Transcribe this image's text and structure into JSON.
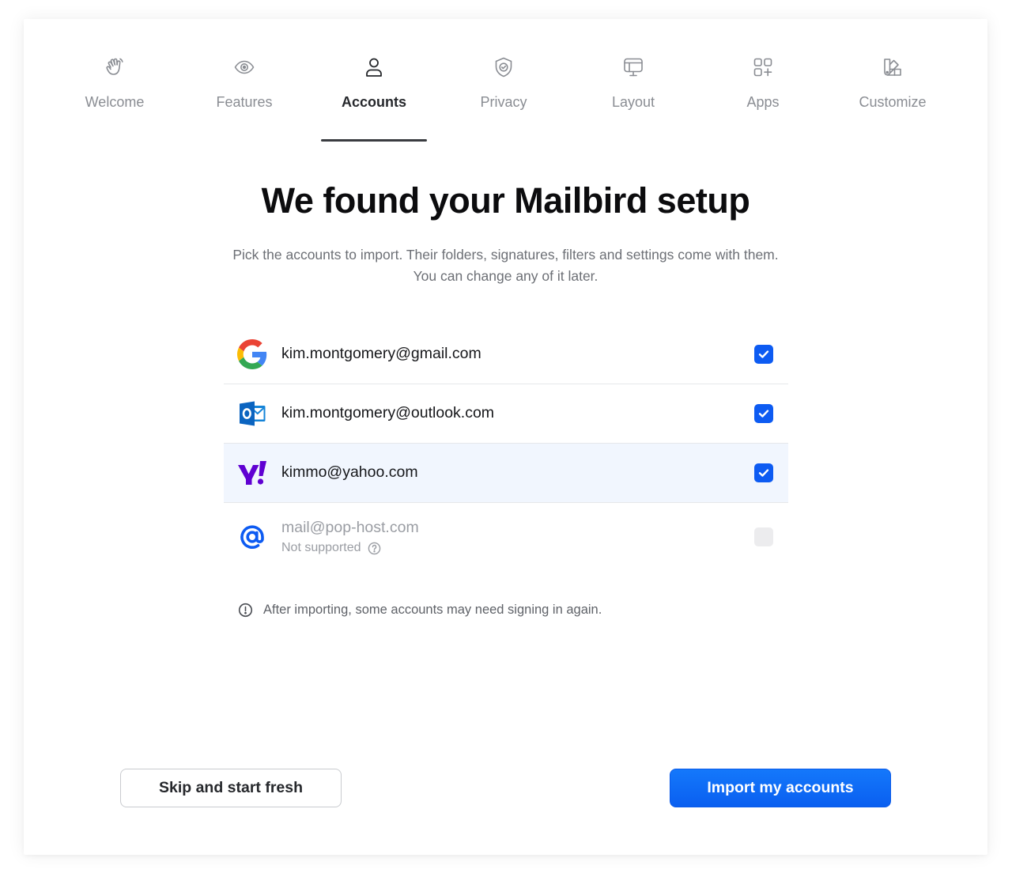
{
  "steps": [
    {
      "label": "Welcome",
      "icon": "waving-hand-icon",
      "active": false
    },
    {
      "label": "Features",
      "icon": "eye-icon",
      "active": false
    },
    {
      "label": "Accounts",
      "icon": "user-icon",
      "active": true
    },
    {
      "label": "Privacy",
      "icon": "shield-check-icon",
      "active": false
    },
    {
      "label": "Layout",
      "icon": "monitor-layout-icon",
      "active": false
    },
    {
      "label": "Apps",
      "icon": "apps-grid-icon",
      "active": false
    },
    {
      "label": "Customize",
      "icon": "palette-swatch-icon",
      "active": false
    }
  ],
  "header": {
    "title": "We found your Mailbird setup",
    "subtitle_line1": "Pick the accounts to import. Their folders, signatures, filters and settings come with them.",
    "subtitle_line2": "You can change any of it later."
  },
  "accounts": [
    {
      "email": "kim.montgomery@gmail.com",
      "provider": "google-logo-icon",
      "checked": true,
      "supported": true
    },
    {
      "email": "kim.montgomery@outlook.com",
      "provider": "outlook-logo-icon",
      "checked": true,
      "supported": true
    },
    {
      "email": "kimmo@yahoo.com",
      "provider": "yahoo-logo-icon",
      "checked": true,
      "supported": true
    },
    {
      "email": "mail@pop-host.com",
      "provider": "at-sign-icon",
      "checked": false,
      "supported": false,
      "note": "Not supported"
    }
  ],
  "note": {
    "text": "After importing, some accounts may need signing in again.",
    "icon": "info-circle-icon"
  },
  "buttons": {
    "skip_label": "Skip and start fresh",
    "import_label": "Import my accounts"
  },
  "colors": {
    "accent": "#0d5bf2",
    "highlight_row": "#f1f6fe",
    "text_primary": "#16171a",
    "text_muted": "#8a8d93"
  }
}
